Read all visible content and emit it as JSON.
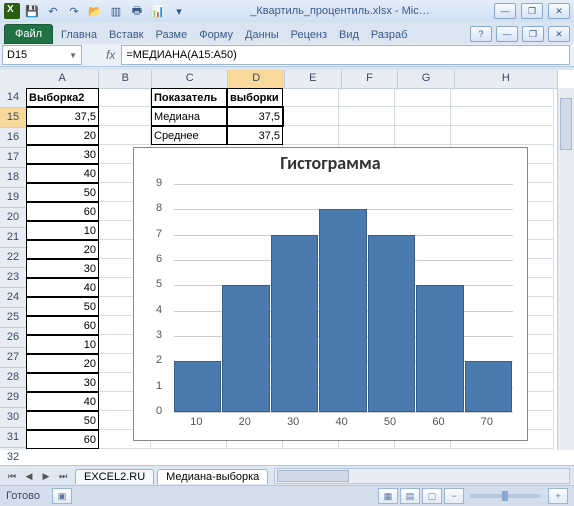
{
  "titlebar": {
    "filename": "_Квартиль_процентиль.xlsx - Mic…",
    "qat": {
      "save": "💾",
      "undo": "↶",
      "redo": "↷",
      "open": "📂",
      "new": "▥",
      "print": "🖶",
      "chart": "📊"
    }
  },
  "winctrl": {
    "min": "—",
    "max": "❐",
    "close": "✕",
    "help": "?"
  },
  "ribbon": {
    "file": "Файл",
    "tabs": [
      "Главна",
      "Вставк",
      "Разме",
      "Форму",
      "Данны",
      "Реценз",
      "Вид",
      "Разраб"
    ]
  },
  "namebox": "D15",
  "formula": "=МЕДИАНА(A15:A50)",
  "columns": [
    "A",
    "B",
    "C",
    "D",
    "E",
    "F",
    "G",
    "H"
  ],
  "row_start": 14,
  "row_end": 32,
  "cells": {
    "header": {
      "A14": "Выборка2",
      "C14": "Показатель",
      "D14": "выборки"
    },
    "stats": {
      "C15": "Медиана",
      "D15": "37,5",
      "C16": "Среднее",
      "D16": "37,5"
    },
    "A": [
      "37,5",
      "20",
      "30",
      "40",
      "50",
      "60",
      "10",
      "20",
      "30",
      "40",
      "50",
      "60",
      "10",
      "20",
      "30",
      "40",
      "50",
      "60"
    ]
  },
  "chart_data": {
    "type": "bar",
    "title": "Гистограмма",
    "categories": [
      10,
      20,
      30,
      40,
      50,
      60,
      70
    ],
    "values": [
      2,
      5,
      7,
      8,
      7,
      5,
      2
    ],
    "xlabel": "",
    "ylabel": "",
    "ylim": [
      0,
      9
    ],
    "yticks": [
      0,
      1,
      2,
      3,
      4,
      5,
      6,
      7,
      8,
      9
    ]
  },
  "sheets": {
    "tabs": [
      "EXCEL2.RU",
      "Медиана-выборка"
    ],
    "active": 1
  },
  "statusbar": {
    "ready": "Готово",
    "zoom_minus": "−",
    "zoom_plus": "+"
  }
}
